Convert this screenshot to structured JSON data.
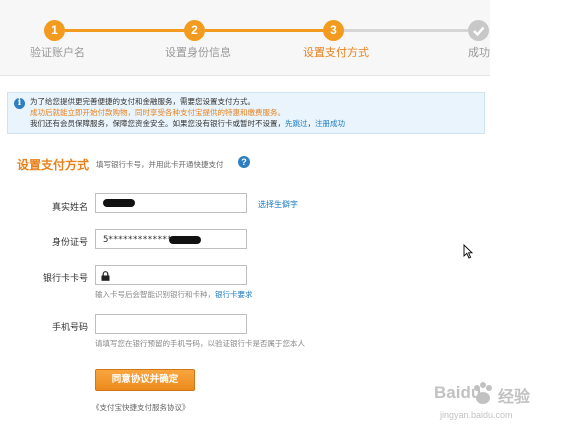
{
  "stepper": {
    "steps": [
      {
        "number": "1",
        "label": "验证账户名",
        "state": "done"
      },
      {
        "number": "2",
        "label": "设置身份信息",
        "state": "done"
      },
      {
        "number": "3",
        "label": "设置支付方式",
        "state": "active"
      },
      {
        "number": "",
        "label": "成功",
        "state": "pending"
      }
    ],
    "colors": {
      "done": "#f29b1f",
      "pending": "#c8c8c8"
    }
  },
  "notice": {
    "line1": "为了给您提供更完善便捷的支付和金融服务，需要您设置支付方式。",
    "line2": "成功后就能立即开始付款购物，同时享受各种支付宝提供的特惠和缴费服务。",
    "line3_prefix": "我们还有会员保障服务，保障您资金安全。如果您没有银行卡或暂时不设置，",
    "line3_link1": "先跳过",
    "line3_sep": "，",
    "line3_link2": "注册成功"
  },
  "section": {
    "title": "设置支付方式",
    "subtitle": "填写银行卡号，并用此卡开通快捷支付"
  },
  "form": {
    "name_label": "真实姓名",
    "name_value": "",
    "rare_char_link": "选择生僻字",
    "id_label": "身份证号",
    "id_value": "5*************",
    "card_label": "银行卡卡号",
    "card_value": "",
    "card_hint": "输入卡号后会智能识别银行和卡种，",
    "card_hint_link": "银行卡要求",
    "phone_label": "手机号码",
    "phone_value": "",
    "phone_hint": "请填写您在银行预留的手机号码，以验证银行卡是否属于您本人",
    "submit_label": "同意协议并确定",
    "agreement_link": "《支付宝快捷支付服务协议》"
  },
  "watermark": {
    "brand": "Baidu",
    "text": "经验",
    "url": "jingyan.baidu.com"
  }
}
